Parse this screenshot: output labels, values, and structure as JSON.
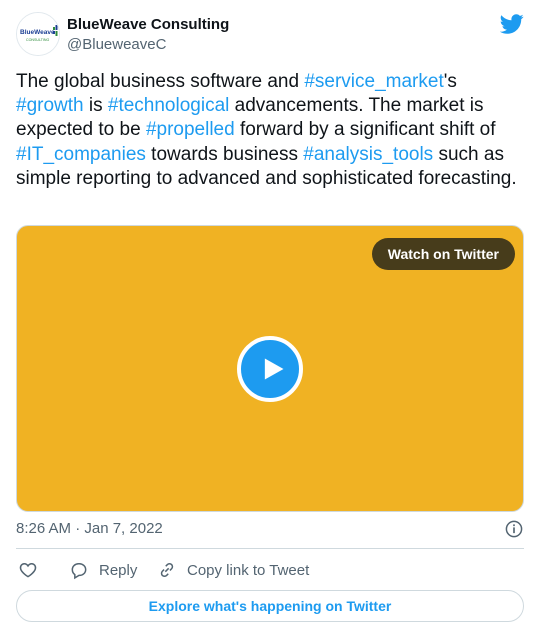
{
  "author": {
    "name": "BlueWeave Consulting",
    "handle": "@BlueweaveC",
    "avatar_text": "BlueWeave",
    "avatar_subtext": "CONSULTING"
  },
  "tweet": {
    "segments": [
      {
        "text": "The global business software and ",
        "hashtag": false
      },
      {
        "text": "#service_market",
        "hashtag": true
      },
      {
        "text": "'s ",
        "hashtag": false
      },
      {
        "text": "#growth",
        "hashtag": true
      },
      {
        "text": " is ",
        "hashtag": false
      },
      {
        "text": "#technological",
        "hashtag": true
      },
      {
        "text": " advancements. The market is expected to be ",
        "hashtag": false
      },
      {
        "text": "#propelled",
        "hashtag": true
      },
      {
        "text": " forward by a significant shift of ",
        "hashtag": false
      },
      {
        "text": "#IT_companies",
        "hashtag": true
      },
      {
        "text": " towards business ",
        "hashtag": false
      },
      {
        "text": "#analysis_tools",
        "hashtag": true
      },
      {
        "text": " such as simple reporting to advanced and sophisticated forecasting.",
        "hashtag": false
      }
    ]
  },
  "media": {
    "watch_label": "Watch on Twitter",
    "background_color": "#f0b223"
  },
  "timestamp": "8:26 AM · Jan 7, 2022",
  "actions": {
    "reply_label": "Reply",
    "copy_label": "Copy link to Tweet"
  },
  "explore_label": "Explore what's happening on Twitter",
  "colors": {
    "accent": "#1d9bf0",
    "secondary_text": "#536471"
  },
  "icons": [
    "twitter-bird-icon",
    "play-icon",
    "info-icon",
    "heart-icon",
    "reply-icon",
    "link-icon"
  ]
}
